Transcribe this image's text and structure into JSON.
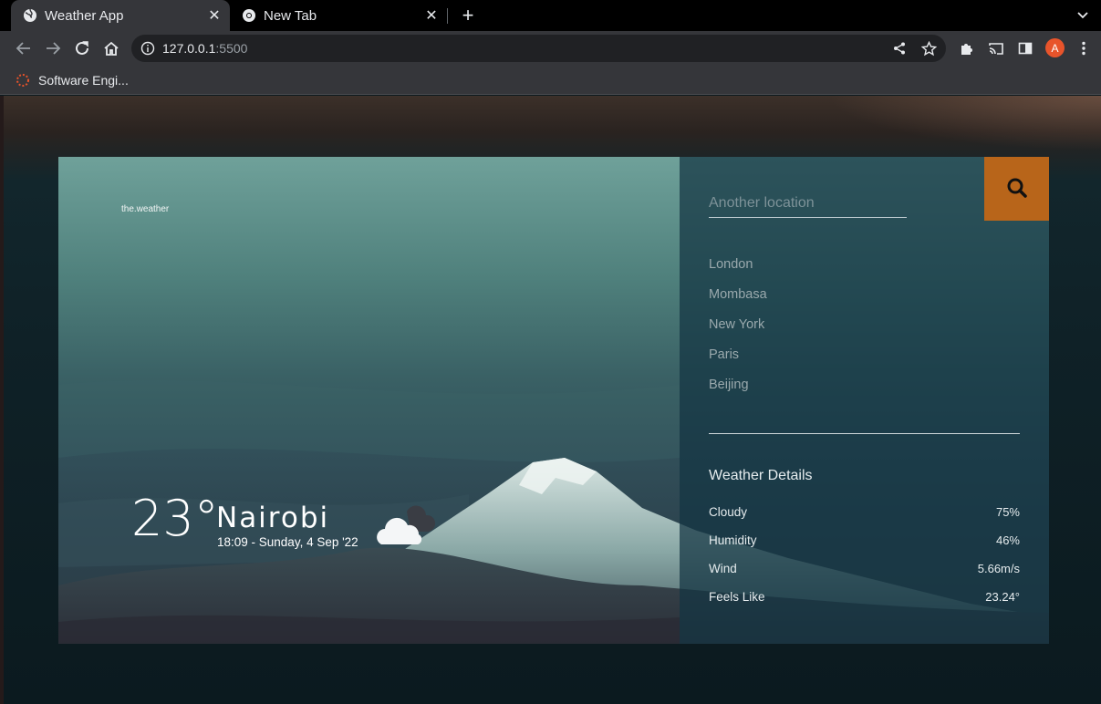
{
  "browser": {
    "tabs": [
      {
        "label": "Weather App",
        "active": true
      },
      {
        "label": "New Tab",
        "active": false
      }
    ],
    "address": {
      "host": "127.0.0.1",
      "port": ":5500"
    },
    "profile_initial": "A",
    "bookmark": "Software Engi..."
  },
  "app": {
    "brand": "the.weather",
    "current": {
      "temperature": "23°",
      "city": "Nairobi",
      "datetime": "18:09 - Sunday, 4 Sep '22",
      "icon": "cloud-icon"
    },
    "search": {
      "placeholder": "Another location"
    },
    "locations": [
      "London",
      "Mombasa",
      "New York",
      "Paris",
      "Beijing"
    ],
    "details": {
      "title": "Weather Details",
      "rows": [
        {
          "label": "Cloudy",
          "value": "75%"
        },
        {
          "label": "Humidity",
          "value": "46%"
        },
        {
          "label": "Wind",
          "value": "5.66m/s"
        },
        {
          "label": "Feels Like",
          "value": "23.24°"
        }
      ]
    }
  },
  "colors": {
    "accent": "#b8651a",
    "tab_bar": "#000000",
    "toolbar": "#35363a",
    "profile": "#e8542b"
  }
}
